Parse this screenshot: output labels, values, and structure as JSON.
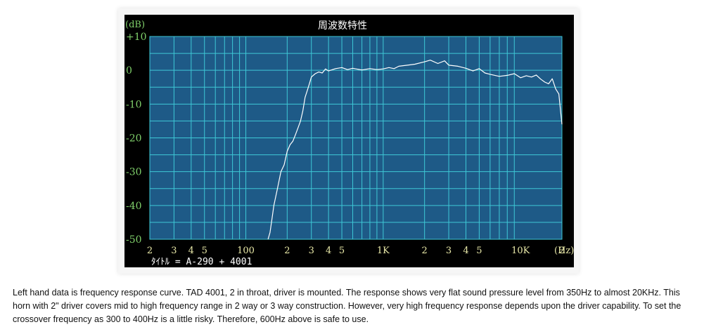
{
  "chart_data": {
    "type": "line",
    "title": "周波数特性",
    "y_unit": "(dB)",
    "x_unit": "(Hz)",
    "footer_label": "ﾀｲﾄﾙ = A-290 + 4001",
    "x_scale": "log",
    "xlim": [
      20,
      20000
    ],
    "ylim": [
      -50,
      10
    ],
    "y_ticks": [
      {
        "value": 10,
        "label": "+10"
      },
      {
        "value": 0,
        "label": "0"
      },
      {
        "value": -10,
        "label": "-10"
      },
      {
        "value": -20,
        "label": "-20"
      },
      {
        "value": -30,
        "label": "-30"
      },
      {
        "value": -40,
        "label": "-40"
      },
      {
        "value": -50,
        "label": "-50"
      }
    ],
    "x_ticks": [
      {
        "value": 20,
        "label": "2"
      },
      {
        "value": 30,
        "label": "3"
      },
      {
        "value": 40,
        "label": "4"
      },
      {
        "value": 50,
        "label": "5"
      },
      {
        "value": 100,
        "label": "100"
      },
      {
        "value": 200,
        "label": "2"
      },
      {
        "value": 300,
        "label": "3"
      },
      {
        "value": 400,
        "label": "4"
      },
      {
        "value": 500,
        "label": "5"
      },
      {
        "value": 1000,
        "label": "1K"
      },
      {
        "value": 2000,
        "label": "2"
      },
      {
        "value": 3000,
        "label": "3"
      },
      {
        "value": 4000,
        "label": "4"
      },
      {
        "value": 5000,
        "label": "5"
      },
      {
        "value": 10000,
        "label": "10K"
      },
      {
        "value": 20000,
        "label": "2"
      }
    ],
    "grid": true,
    "series": [
      {
        "color": "#ffffff",
        "x": [
          145,
          150,
          155,
          160,
          170,
          180,
          190,
          200,
          210,
          220,
          230,
          240,
          250,
          260,
          270,
          280,
          290,
          300,
          320,
          340,
          360,
          380,
          400,
          450,
          500,
          550,
          600,
          700,
          800,
          900,
          1000,
          1100,
          1200,
          1300,
          1500,
          1700,
          2000,
          2200,
          2500,
          2800,
          3000,
          3500,
          4000,
          4500,
          5000,
          5500,
          6000,
          7000,
          8000,
          9000,
          10000,
          11000,
          12000,
          13000,
          14000,
          15000,
          16000,
          17000,
          18000,
          19000,
          20000
        ],
        "y": [
          -50,
          -48,
          -44,
          -40,
          -35,
          -30,
          -28,
          -24,
          -22,
          -21,
          -19,
          -17,
          -15,
          -12,
          -8,
          -6,
          -4,
          -2,
          -1,
          -0.5,
          -0.8,
          0.4,
          -0.2,
          0.5,
          0.8,
          0.2,
          0.6,
          0.1,
          0.5,
          0.2,
          0.4,
          0.8,
          0.5,
          1.2,
          1.5,
          1.8,
          2.5,
          3.0,
          2.0,
          2.8,
          1.5,
          1.2,
          0.6,
          -0.2,
          0.5,
          -0.8,
          -1.2,
          -1.8,
          -1.5,
          -1.0,
          -2.2,
          -1.6,
          -2.0,
          -1.4,
          -2.6,
          -3.5,
          -4.0,
          -2.5,
          -5.5,
          -7.0,
          -16.0
        ]
      }
    ]
  },
  "caption": "Left hand data is frequency response curve. TAD 4001, 2 in throat, driver is mounted. The response shows very flat sound pressure level from 350Hz to almost 20KHz. This horn with 2\" driver covers mid to high frequency range in 2 way or 3 way construction. However, very high frequency response depends upon the driver capability. To set the crossover frequency as 300 to 400Hz is a little risky. Therefore, 600Hz above is safe to use."
}
